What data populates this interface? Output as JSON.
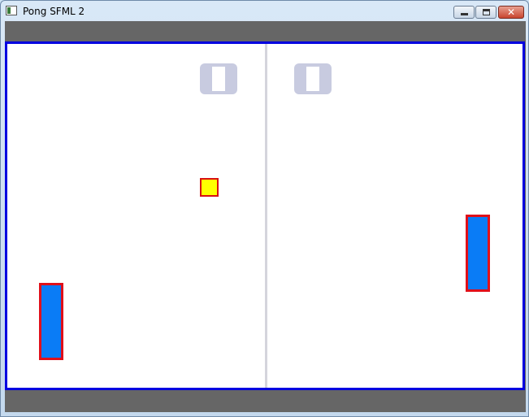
{
  "window": {
    "title": "Pong SFML 2",
    "close_glyph": "✕"
  },
  "game": {
    "score_left": "0",
    "score_right": "0",
    "colors": {
      "background": "#ffffff",
      "border": "#0000e0",
      "bars": "#666666",
      "paddle_fill": "#0a7cf6",
      "paddle_outline": "#e0101a",
      "ball_fill": "#ffff00",
      "ball_outline": "#d81010",
      "midline": "#d4d4dc",
      "score_digits": "#c8cbe0"
    }
  }
}
